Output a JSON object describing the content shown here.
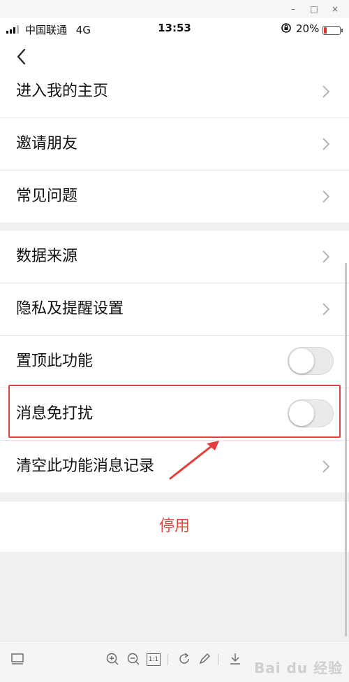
{
  "window": {
    "controls": [
      "–",
      "□",
      "×"
    ]
  },
  "status_bar": {
    "carrier": "中国联通",
    "network": "4G",
    "time": "13:53",
    "orientation_lock_icon": "orientation-lock-icon",
    "battery_percent": "20%",
    "battery_level": 0.2,
    "battery_color": "#e0302b"
  },
  "nav": {
    "back_icon": "chevron-left-icon"
  },
  "group1": {
    "items": [
      {
        "label": "进入我的主页"
      },
      {
        "label": "邀请朋友"
      },
      {
        "label": "常见问题"
      }
    ]
  },
  "group2": {
    "items": [
      {
        "label": "数据来源"
      },
      {
        "label": "隐私及提醒设置"
      },
      {
        "label": "置顶此功能",
        "toggle": false
      },
      {
        "label": "消息免打扰",
        "toggle": false
      },
      {
        "label": "清空此功能消息记录"
      }
    ]
  },
  "stop": {
    "label": "停用",
    "color": "#e0483f"
  },
  "annotation": {
    "highlight_color": "#e53e3e"
  },
  "viewer_toolbar": {
    "zoom_reset_label": "1:1",
    "watermark": "Bai du 经验"
  }
}
